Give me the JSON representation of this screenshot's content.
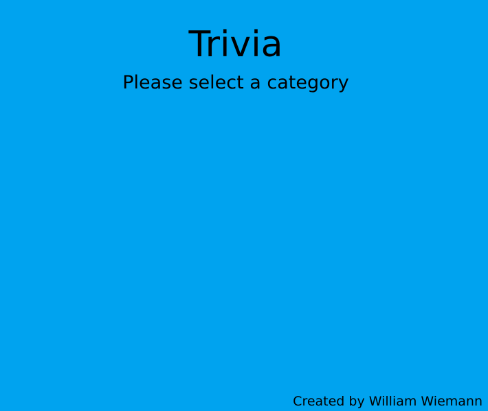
{
  "app": {
    "title": "Trivia",
    "prompt": "Please select a category",
    "credit": "Created by William Wiemann"
  },
  "colors": {
    "background": "#00a3ef",
    "text": "#000000"
  },
  "categories": []
}
